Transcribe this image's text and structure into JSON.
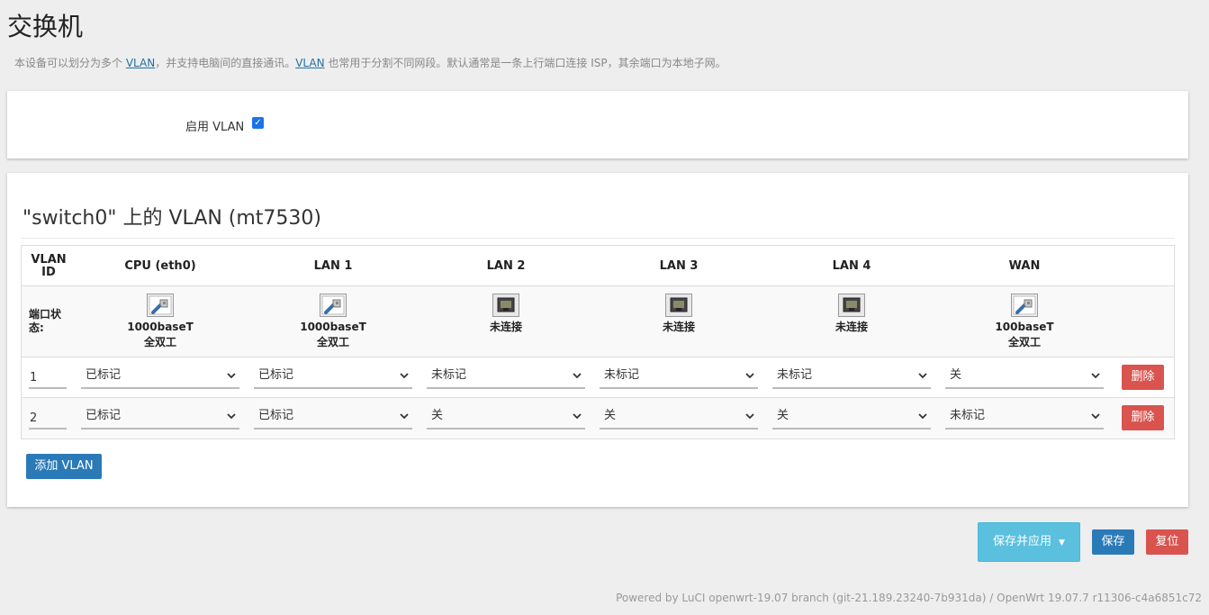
{
  "page": {
    "title": "交换机",
    "desc_pre": "本设备可以划分为多个 ",
    "desc_link1": "VLAN",
    "desc_mid": "，并支持电脑间的直接通讯。",
    "desc_link2": "VLAN",
    "desc_post": " 也常用于分割不同网段。默认通常是一条上行端口连接 ISP，其余端口为本地子网。"
  },
  "enable": {
    "label": "启用 VLAN",
    "checked": true
  },
  "switch": {
    "title": "\"switch0\" 上的 VLAN (mt7530)",
    "headers": {
      "vlan_id_line1": "VLAN",
      "vlan_id_line2": "ID",
      "cols": [
        "CPU (eth0)",
        "LAN 1",
        "LAN 2",
        "LAN 3",
        "LAN 4",
        "WAN"
      ]
    },
    "status_label_line1": "端口状",
    "status_label_line2": "态:",
    "port_status": [
      {
        "icon": "port-connected-icon",
        "line1": "1000baseT",
        "line2": "全双工"
      },
      {
        "icon": "port-connected-icon",
        "line1": "1000baseT",
        "line2": "全双工"
      },
      {
        "icon": "port-disconnected-icon",
        "line1": "未连接",
        "line2": ""
      },
      {
        "icon": "port-disconnected-icon",
        "line1": "未连接",
        "line2": ""
      },
      {
        "icon": "port-disconnected-icon",
        "line1": "未连接",
        "line2": ""
      },
      {
        "icon": "port-connected-icon",
        "line1": "100baseT",
        "line2": "全双工"
      }
    ],
    "rows": [
      {
        "vid": "1",
        "values": [
          "已标记",
          "已标记",
          "未标记",
          "未标记",
          "未标记",
          "关"
        ],
        "delete_label": "删除"
      },
      {
        "vid": "2",
        "values": [
          "已标记",
          "已标记",
          "关",
          "关",
          "关",
          "未标记"
        ],
        "delete_label": "删除"
      }
    ],
    "add_label": "添加 VLAN"
  },
  "actions": {
    "save_apply": "保存并应用",
    "save": "保存",
    "reset": "复位"
  },
  "footer": "Powered by LuCI openwrt-19.07 branch (git-21.189.23240-7b931da) / OpenWrt 19.07.7 r11306-c4a6851c72",
  "colors": {
    "accent": "#2a7ab8",
    "danger": "#d9534f",
    "info": "#5bc0de"
  }
}
